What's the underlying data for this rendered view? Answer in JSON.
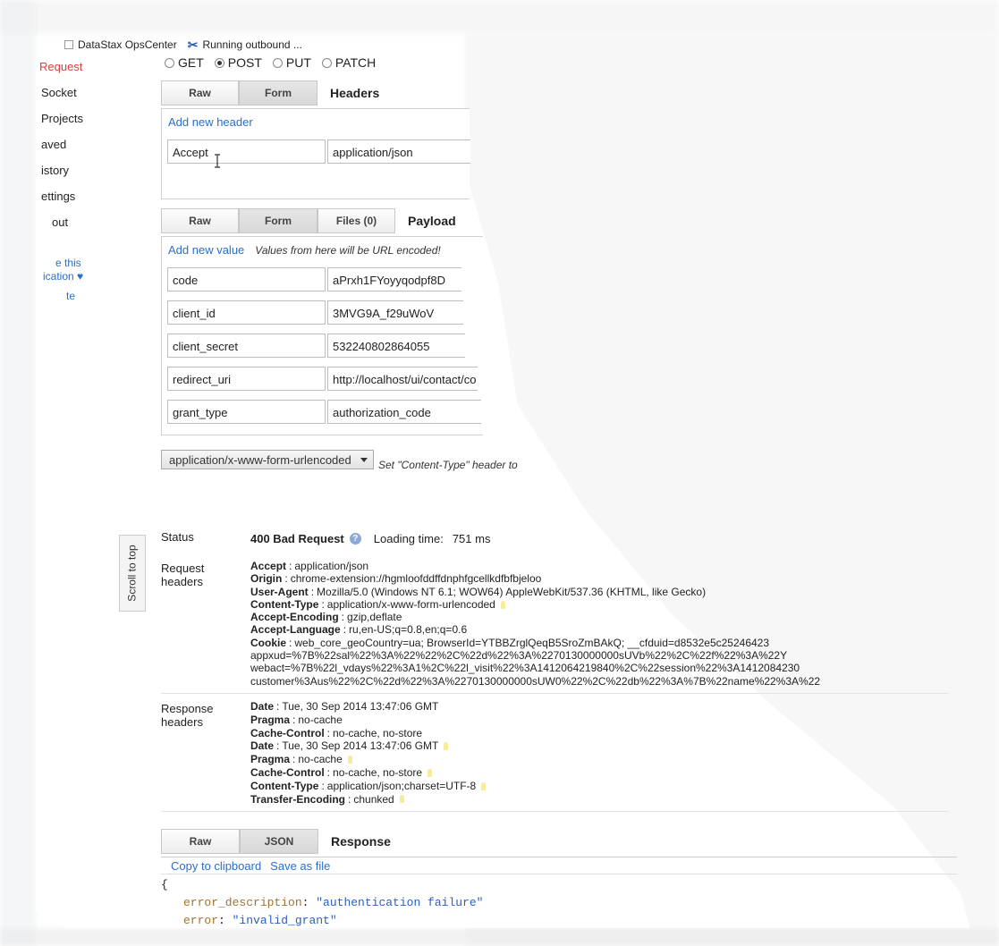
{
  "bookmarks": [
    {
      "label": "DataStax OpsCenter",
      "icon": "page-icon"
    },
    {
      "label": "Running outbound ...",
      "icon": "tools-icon"
    }
  ],
  "sidebar": {
    "items": [
      "Request",
      "Socket",
      "Projects",
      "aved",
      "istory",
      "ettings",
      "out"
    ],
    "links": [
      "e this",
      "ication ♥",
      "te"
    ]
  },
  "methods": [
    {
      "label": "GET",
      "selected": false
    },
    {
      "label": "POST",
      "selected": true
    },
    {
      "label": "PUT",
      "selected": false
    },
    {
      "label": "PATCH",
      "selected": false
    }
  ],
  "headers_section": {
    "tabs": [
      "Raw",
      "Form"
    ],
    "title": "Headers",
    "add_label": "Add new header",
    "rows": [
      {
        "key": "Accept",
        "value": "application/json"
      }
    ]
  },
  "payload_section": {
    "tabs": [
      "Raw",
      "Form",
      "Files (0)"
    ],
    "title": "Payload",
    "add_label": "Add new value",
    "hint": "Values from here will be URL encoded!",
    "rows": [
      {
        "key": "code",
        "value": "aPrxh1FYoyyqodpf8D"
      },
      {
        "key": "client_id",
        "value": "3MVG9A_f29uWoV"
      },
      {
        "key": "client_secret",
        "value": "532240802864055"
      },
      {
        "key": "redirect_uri",
        "value": "http://localhost/ui/contact/co"
      },
      {
        "key": "grant_type",
        "value": "authorization_code"
      }
    ]
  },
  "content_type": {
    "selected": "application/x-www-form-urlencoded",
    "hint": "Set \"Content-Type\" header to"
  },
  "scroll_top_label": "Scroll to top",
  "status": {
    "label": "Status",
    "code": "400 Bad Request",
    "loading_label": "Loading time:",
    "loading_value": "751 ms"
  },
  "request_headers": {
    "label_line1": "Request",
    "label_line2": "headers",
    "items": [
      {
        "k": "Accept",
        "v": "application/json"
      },
      {
        "k": "Origin",
        "v": "chrome-extension://hgmloofddffdnphfgcellkdfbfbjeloo"
      },
      {
        "k": "User-Agent",
        "v": "Mozilla/5.0 (Windows NT 6.1; WOW64) AppleWebKit/537.36 (KHTML, like Gecko)"
      },
      {
        "k": "Content-Type",
        "v": "application/x-www-form-urlencoded",
        "bulb": true
      },
      {
        "k": "Accept-Encoding",
        "v": "gzip,deflate"
      },
      {
        "k": "Accept-Language",
        "v": "ru,en-US;q=0.8,en;q=0.6"
      },
      {
        "k": "Cookie",
        "v": "web_core_geoCountry=ua; BrowserId=YTBBZrglQeqB5SroZmBAkQ; __cfduid=d8532e5c25246423"
      }
    ],
    "cookie_cont": [
      "appxud=%7B%22sal%22%3A%22%22%2C%22d%22%3A%2270130000000sUVb%22%2C%22f%22%3A%22Y",
      "webact=%7B%22l_vdays%22%3A1%2C%22l_visit%22%3A1412064219840%2C%22session%22%3A1412084230",
      "customer%3Aus%22%2C%22d%22%3A%2270130000000sUW0%22%2C%22db%22%3A%7B%22name%22%3A%22"
    ]
  },
  "response_headers": {
    "label_line1": "Response",
    "label_line2": "headers",
    "items": [
      {
        "k": "Date",
        "v": "Tue, 30 Sep 2014 13:47:06 GMT"
      },
      {
        "k": "Pragma",
        "v": "no-cache"
      },
      {
        "k": "Cache-Control",
        "v": "no-cache, no-store"
      },
      {
        "k": "Date",
        "v": "Tue, 30 Sep 2014 13:47:06 GMT",
        "bulb": true
      },
      {
        "k": "Pragma",
        "v": "no-cache",
        "bulb": true
      },
      {
        "k": "Cache-Control",
        "v": "no-cache, no-store",
        "bulb": true
      },
      {
        "k": "Content-Type",
        "v": "application/json;charset=UTF-8",
        "bulb": true
      },
      {
        "k": "Transfer-Encoding",
        "v": "chunked",
        "bulb": true
      }
    ]
  },
  "response_section": {
    "tabs": [
      "Raw",
      "JSON"
    ],
    "title": "Response",
    "copy_label": "Copy to clipboard",
    "save_label": "Save as file",
    "json_open": "{",
    "json_lines": [
      {
        "key": "error_description",
        "value": "\"authentication failure\""
      },
      {
        "key": "error",
        "value": "\"invalid_grant\""
      }
    ]
  },
  "colors": {
    "link": "#2a6fc9",
    "active_nav": "#d9403a"
  }
}
